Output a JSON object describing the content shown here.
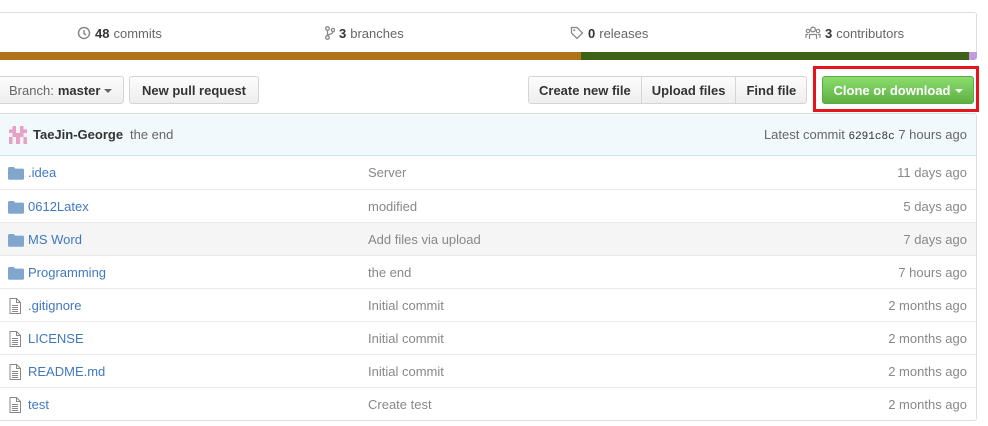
{
  "stats": {
    "commits": {
      "count": "48",
      "label": "commits"
    },
    "branches": {
      "count": "3",
      "label": "branches"
    },
    "releases": {
      "count": "0",
      "label": "releases"
    },
    "contributors": {
      "count": "3",
      "label": "contributors"
    }
  },
  "language_bar": [
    {
      "color": "#b07219",
      "fraction": 0.596
    },
    {
      "color": "#3d6117",
      "fraction": 0.396
    },
    {
      "color": "#c39ae0",
      "fraction": 0.008
    }
  ],
  "toolbar": {
    "branch_prefix": "Branch:",
    "branch_name": "master",
    "new_pull_request": "New pull request",
    "create_new_file": "Create new file",
    "upload_files": "Upload files",
    "find_file": "Find file",
    "clone_or_download": "Clone or download"
  },
  "latest_commit": {
    "author": "TaeJin-George",
    "message": "the end",
    "label": "Latest commit",
    "sha": "6291c8c",
    "age": "7 hours ago"
  },
  "files": [
    {
      "type": "folder",
      "name": ".idea",
      "message": "Server",
      "age": "11 days ago"
    },
    {
      "type": "folder",
      "name": "0612Latex",
      "message": "modified",
      "age": "5 days ago"
    },
    {
      "type": "folder",
      "name": "MS Word",
      "message": "Add files via upload",
      "age": "7 days ago"
    },
    {
      "type": "folder",
      "name": "Programming",
      "message": "the end",
      "age": "7 hours ago"
    },
    {
      "type": "file",
      "name": ".gitignore",
      "message": "Initial commit",
      "age": "2 months ago"
    },
    {
      "type": "file",
      "name": "LICENSE",
      "message": "Initial commit",
      "age": "2 months ago"
    },
    {
      "type": "file",
      "name": "README.md",
      "message": "Initial commit",
      "age": "2 months ago"
    },
    {
      "type": "file",
      "name": "test",
      "message": "Create test",
      "age": "2 months ago"
    }
  ]
}
